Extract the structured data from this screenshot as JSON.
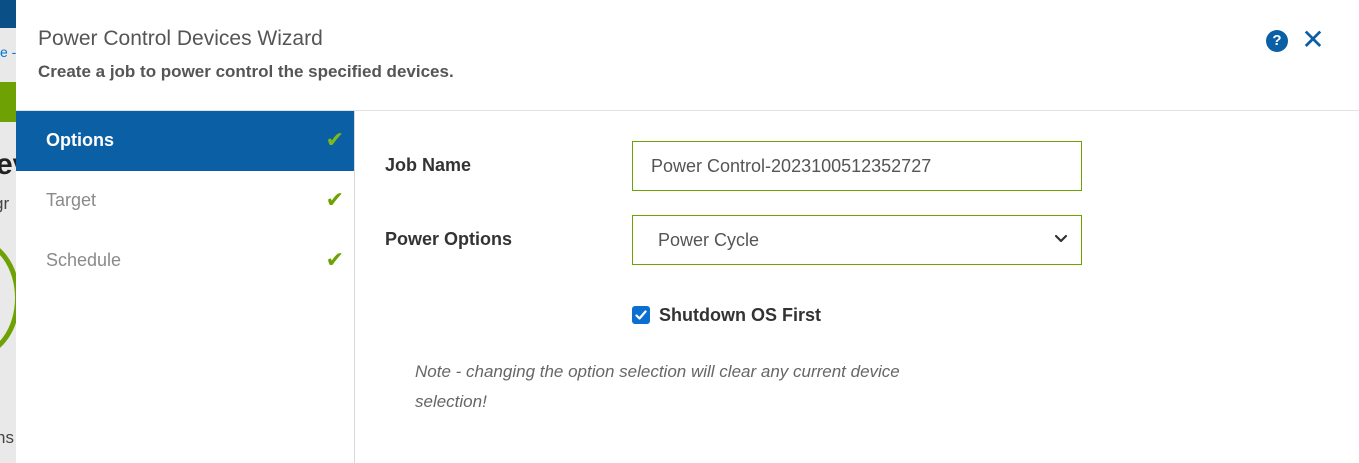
{
  "background": {
    "link_fragment": "e -",
    "heading_fragment": "ev",
    "subtext_fragment": "gr",
    "bottom_fragment": "ns"
  },
  "dialog": {
    "title": "Power Control Devices Wizard",
    "subtitle": "Create a job to power control the specified devices.",
    "help_icon": "?",
    "close_icon": "✕"
  },
  "steps": [
    {
      "label": "Options",
      "active": true,
      "completed": true
    },
    {
      "label": "Target",
      "active": false,
      "completed": true
    },
    {
      "label": "Schedule",
      "active": false,
      "completed": true
    }
  ],
  "form": {
    "job_name_label": "Job Name",
    "job_name_value": "Power Control-2023100512352727",
    "power_options_label": "Power Options",
    "power_options_selected": "Power Cycle",
    "shutdown_label": "Shutdown OS First",
    "shutdown_checked": true,
    "note": "Note - changing the option selection will clear any current device selection!"
  },
  "colors": {
    "accent_blue": "#0b5fa5",
    "success_green": "#6ea204"
  }
}
